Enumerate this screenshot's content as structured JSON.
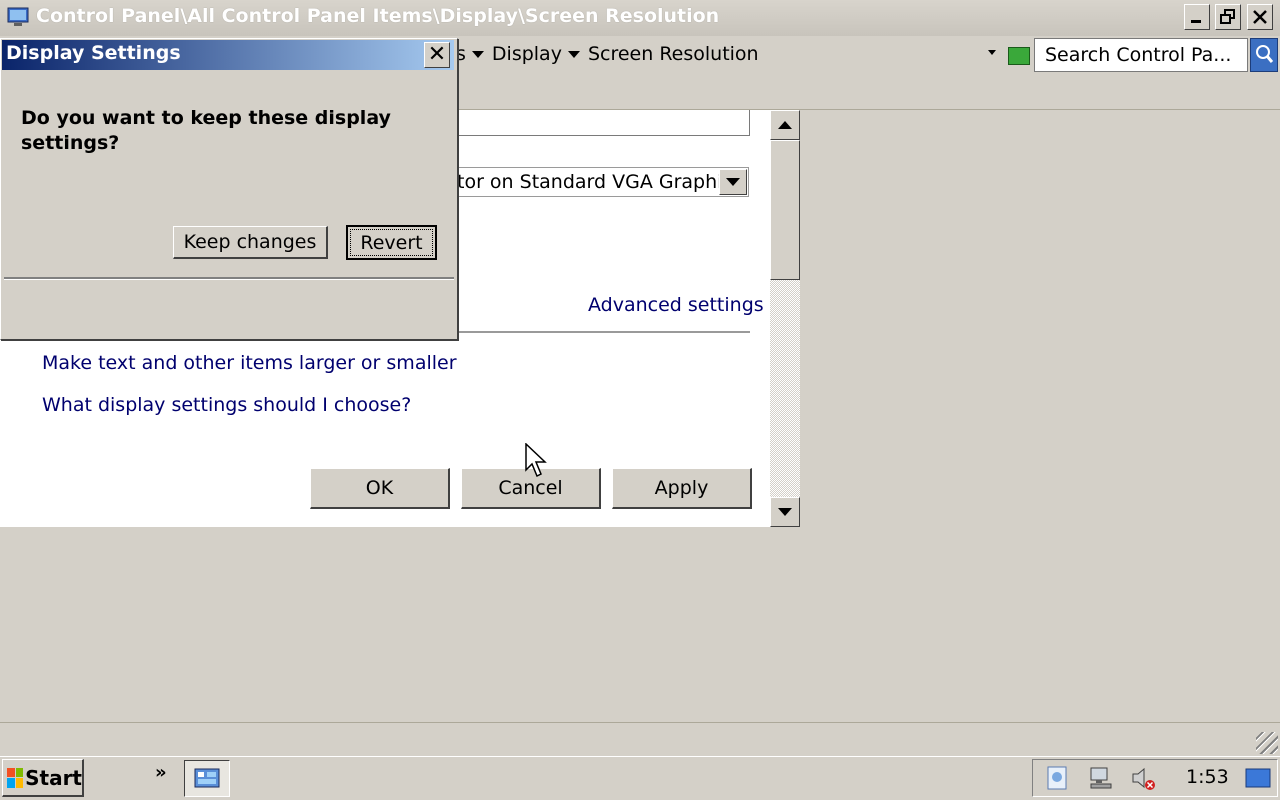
{
  "window": {
    "title": "Control Panel\\All Control Panel Items\\Display\\Screen Resolution"
  },
  "address_bar": {
    "crumbs": [
      "s",
      "Display",
      "Screen Resolution"
    ],
    "search_placeholder": "Search Control Pa..."
  },
  "content": {
    "display_select_value": "tor on Standard VGA Graphics",
    "advanced_link": "Advanced settings",
    "links": [
      "Make text and other items larger or smaller",
      "What display settings should I choose?"
    ],
    "buttons": {
      "ok": "OK",
      "cancel": "Cancel",
      "apply": "Apply"
    }
  },
  "dialog": {
    "title": "Display Settings",
    "close_glyph": "✕",
    "question": "Do you want to keep these display settings?",
    "keep_label": "Keep changes",
    "revert_label": "Revert"
  },
  "taskbar": {
    "start_label": "Start",
    "quick_launch_glyph": "»",
    "clock": "1:53"
  },
  "colors": {
    "link": "#00006e",
    "dialog_title_start": "#0a246a",
    "dialog_title_end": "#a6caf0"
  }
}
